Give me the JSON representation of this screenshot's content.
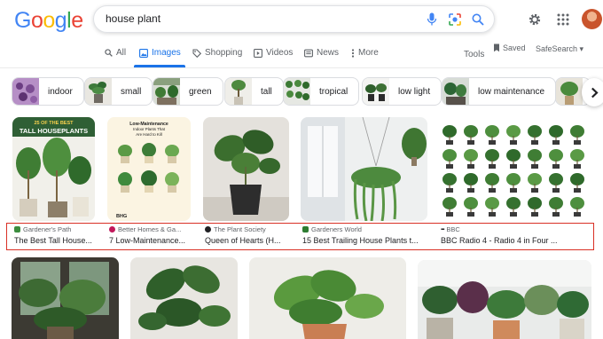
{
  "header": {
    "logo": "Google",
    "logo_colors": [
      "#4285f4",
      "#ea4335",
      "#fbbc05",
      "#4285f4",
      "#34a853",
      "#ea4335"
    ],
    "search_query": "house plant",
    "icons": [
      "microphone-icon",
      "lens-icon",
      "search-icon",
      "gear-icon",
      "apps-icon"
    ]
  },
  "tabs": {
    "items": [
      {
        "label": "All",
        "icon": "search-icon"
      },
      {
        "label": "Images",
        "icon": "image-icon",
        "active": true
      },
      {
        "label": "Shopping",
        "icon": "tag-icon"
      },
      {
        "label": "Videos",
        "icon": "play-icon"
      },
      {
        "label": "News",
        "icon": "news-icon"
      },
      {
        "label": "More",
        "icon": "kebab-icon"
      }
    ],
    "tools": "Tools",
    "saved": "Saved",
    "safesearch": "SafeSearch"
  },
  "chips": [
    {
      "label": "indoor"
    },
    {
      "label": "small"
    },
    {
      "label": "green"
    },
    {
      "label": "tall"
    },
    {
      "label": "tropical"
    },
    {
      "label": "low light"
    },
    {
      "label": "low maintenance"
    }
  ],
  "results_row1": [
    {
      "source": "Gardener's Path",
      "title": "The Best Tall House...",
      "image_text": [
        "25 OF THE BEST",
        "TALL HOUSEPLANTS"
      ],
      "fav_color": "#3c8d3f"
    },
    {
      "source": "Better Homes & Ga...",
      "title": "7 Low-Maintenance...",
      "image_text": [
        "Low-Maintenance",
        "Indoor Plants That",
        "Are Hard to Kill"
      ],
      "image_logo": "BHG",
      "fav_color": "#c2185b"
    },
    {
      "source": "The Plant Society",
      "title": "Queen of Hearts (H...",
      "fav_color": "#202124"
    },
    {
      "source": "Gardeners World",
      "title": "15 Best Trailing House Plants t...",
      "fav_color": "#2e7d32"
    },
    {
      "source": "BBC",
      "title": "BBC Radio 4 - Radio 4 in Four ...",
      "fav_color": "#202124"
    }
  ],
  "accent": "#1a73e8",
  "highlight_color": "#d93025"
}
